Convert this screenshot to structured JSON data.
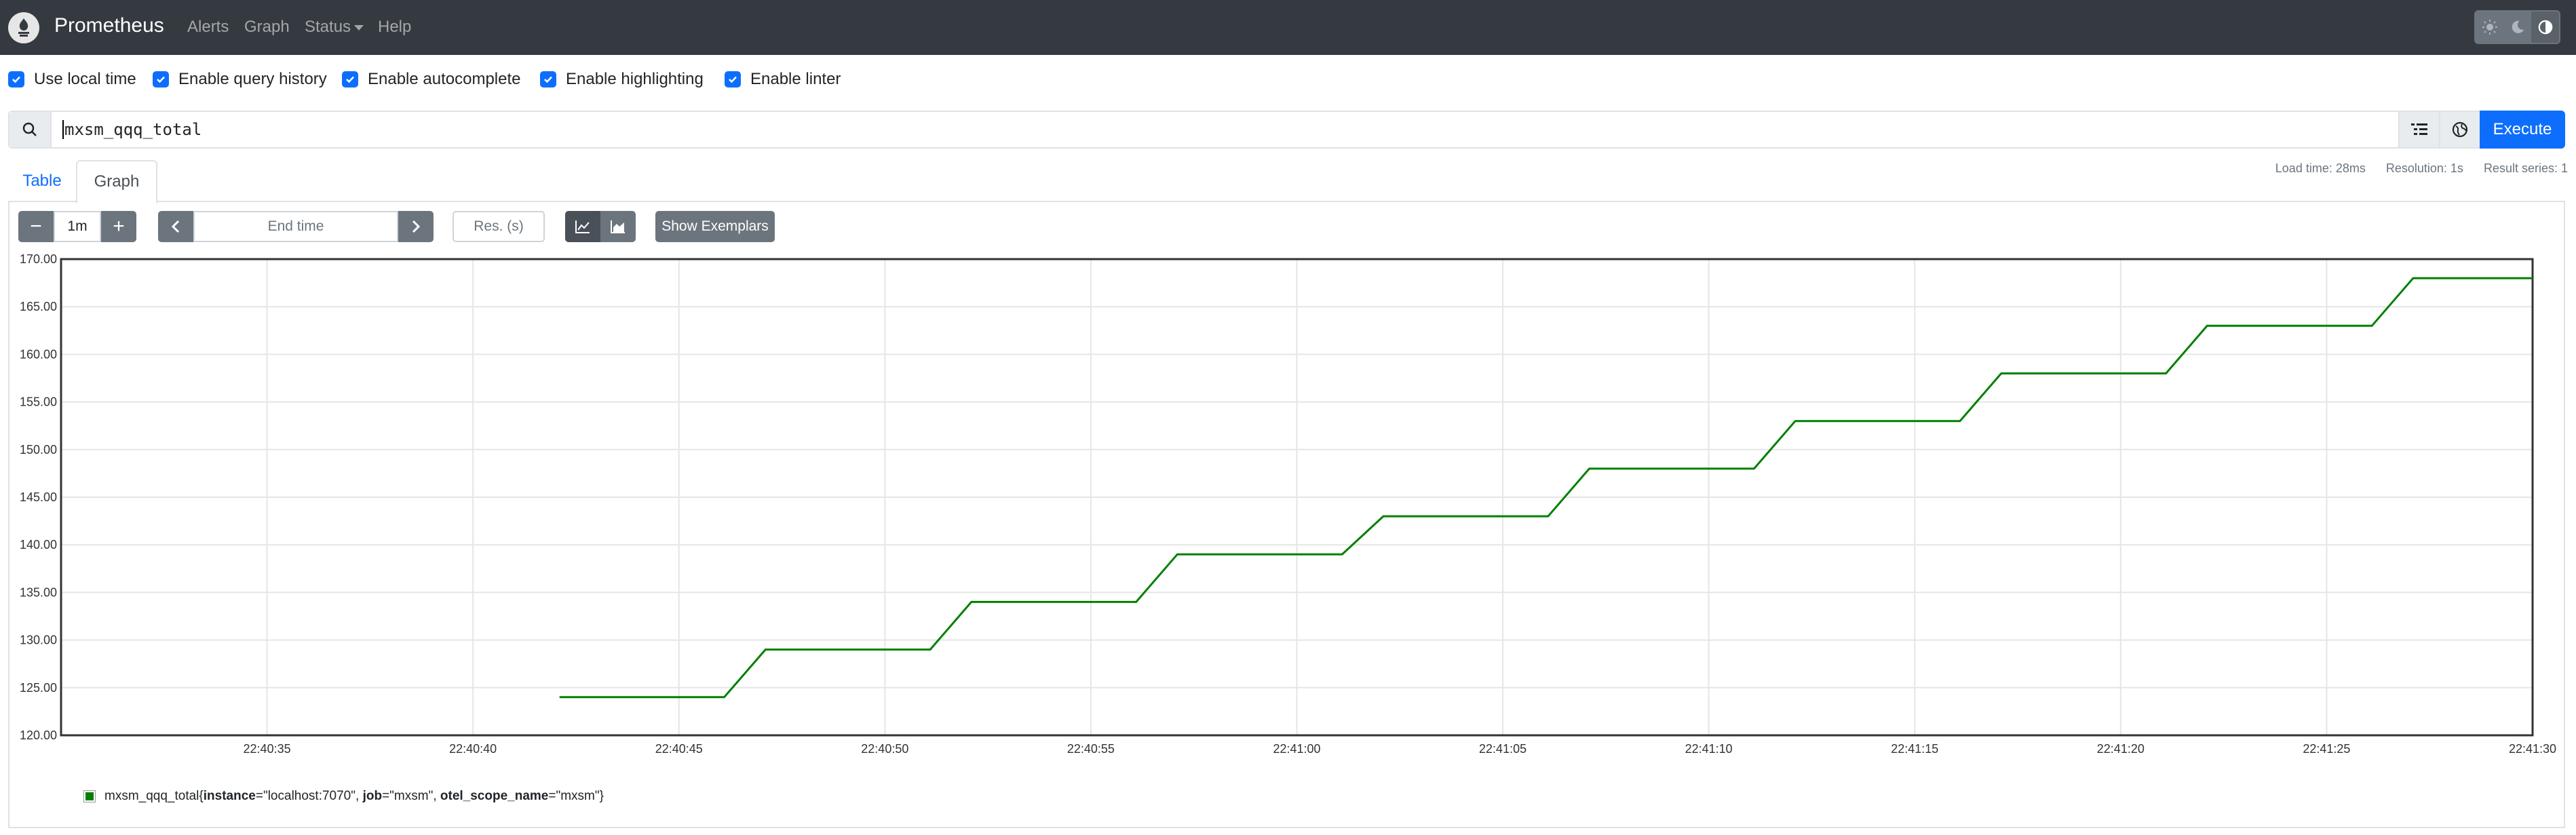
{
  "nav": {
    "brand": "Prometheus",
    "links": [
      "Alerts",
      "Graph",
      "Status",
      "Help"
    ]
  },
  "options": [
    {
      "label": "Use local time",
      "checked": true
    },
    {
      "label": "Enable query history",
      "checked": true
    },
    {
      "label": "Enable autocomplete",
      "checked": true
    },
    {
      "label": "Enable highlighting",
      "checked": true
    },
    {
      "label": "Enable linter",
      "checked": true
    }
  ],
  "query": {
    "expression": "mxsm_qqq_total",
    "execute_label": "Execute"
  },
  "tabs": {
    "table": "Table",
    "graph": "Graph"
  },
  "stats": {
    "load_time": "Load time: 28ms",
    "resolution": "Resolution: 1s",
    "result_series": "Result series: 1"
  },
  "controls": {
    "range": "1m",
    "minus": "−",
    "plus": "+",
    "end_time_placeholder": "End time",
    "res_placeholder": "Res. (s)",
    "show_exemplars": "Show Exemplars"
  },
  "colors": {
    "navbar": "#343a40",
    "primary": "#0d6efd",
    "series": "#008000"
  },
  "chart_data": {
    "type": "line",
    "ylim": [
      120,
      170
    ],
    "y_ticks": [
      "170.00",
      "165.00",
      "160.00",
      "155.00",
      "150.00",
      "145.00",
      "140.00",
      "135.00",
      "130.00",
      "125.00",
      "120.00"
    ],
    "xlim_seconds": [
      30.0,
      90.0
    ],
    "x_ticks": [
      {
        "label": "22:40:35",
        "t": 35
      },
      {
        "label": "22:40:40",
        "t": 40
      },
      {
        "label": "22:40:45",
        "t": 45
      },
      {
        "label": "22:40:50",
        "t": 50
      },
      {
        "label": "22:40:55",
        "t": 55
      },
      {
        "label": "22:41:00",
        "t": 60
      },
      {
        "label": "22:41:05",
        "t": 65
      },
      {
        "label": "22:41:10",
        "t": 70
      },
      {
        "label": "22:41:15",
        "t": 75
      },
      {
        "label": "22:41:20",
        "t": 80
      },
      {
        "label": "22:41:25",
        "t": 85
      },
      {
        "label": "22:41:30",
        "t": 90
      }
    ],
    "series": [
      {
        "legend_metric": "mxsm_qqq_total",
        "labels": [
          {
            "key": "instance",
            "value": "\"localhost:7070\""
          },
          {
            "key": "job",
            "value": "\"mxsm\""
          },
          {
            "key": "otel_scope_name",
            "value": "\"mxsm\""
          }
        ],
        "points": [
          [
            42.1,
            124
          ],
          [
            46.1,
            124
          ],
          [
            47.1,
            129
          ],
          [
            51.1,
            129
          ],
          [
            52.1,
            134
          ],
          [
            56.1,
            134
          ],
          [
            57.1,
            139
          ],
          [
            61.1,
            139
          ],
          [
            62.1,
            143
          ],
          [
            66.1,
            143
          ],
          [
            67.1,
            148
          ],
          [
            71.1,
            148
          ],
          [
            72.1,
            153
          ],
          [
            76.1,
            153
          ],
          [
            77.1,
            158
          ],
          [
            81.1,
            158
          ],
          [
            82.1,
            163
          ],
          [
            86.1,
            163
          ],
          [
            87.1,
            168
          ],
          [
            90.0,
            168
          ]
        ]
      }
    ]
  }
}
